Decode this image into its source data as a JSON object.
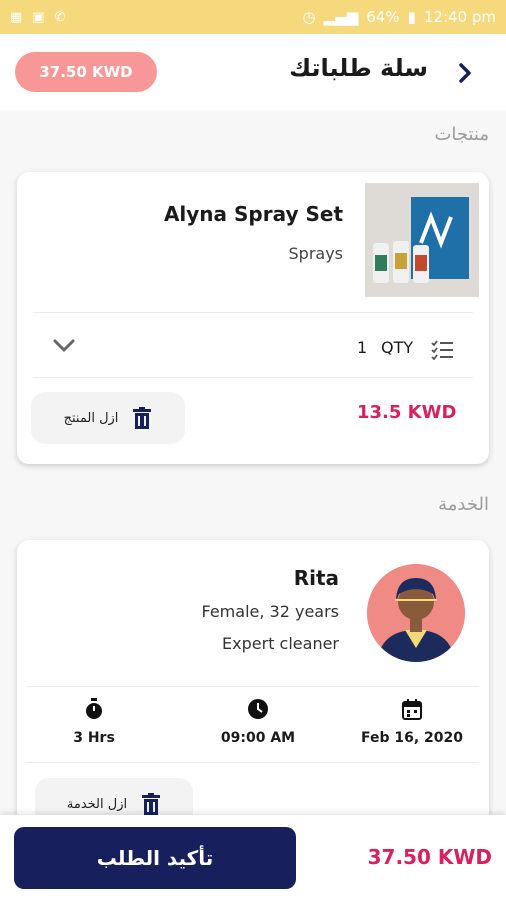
{
  "status_bar": {
    "battery": "64%",
    "time": "12:40 pm"
  },
  "header": {
    "title": "سلة طلباتك",
    "total": "37.50 KWD"
  },
  "sections": {
    "products": "منتجات",
    "service": "الخدمة"
  },
  "product": {
    "name": "Alyna Spray Set",
    "category": "Sprays",
    "qty_label": "QTY",
    "qty": "1",
    "price": "13.5 KWD",
    "remove_label": "ازل المنتج"
  },
  "service": {
    "name": "Rita",
    "info": "Female, 32 years",
    "role": "Expert cleaner",
    "duration": "3 Hrs",
    "time": "09:00 AM",
    "date": "Feb 16, 2020",
    "remove_label": "ازل الخدمة"
  },
  "footer": {
    "confirm_label": "تأكيد الطلب",
    "total": "37.50 KWD"
  },
  "colors": {
    "accent": "#d8215e",
    "primary": "#17205c",
    "pill": "#f79797",
    "statusbar": "#f6d97c"
  }
}
